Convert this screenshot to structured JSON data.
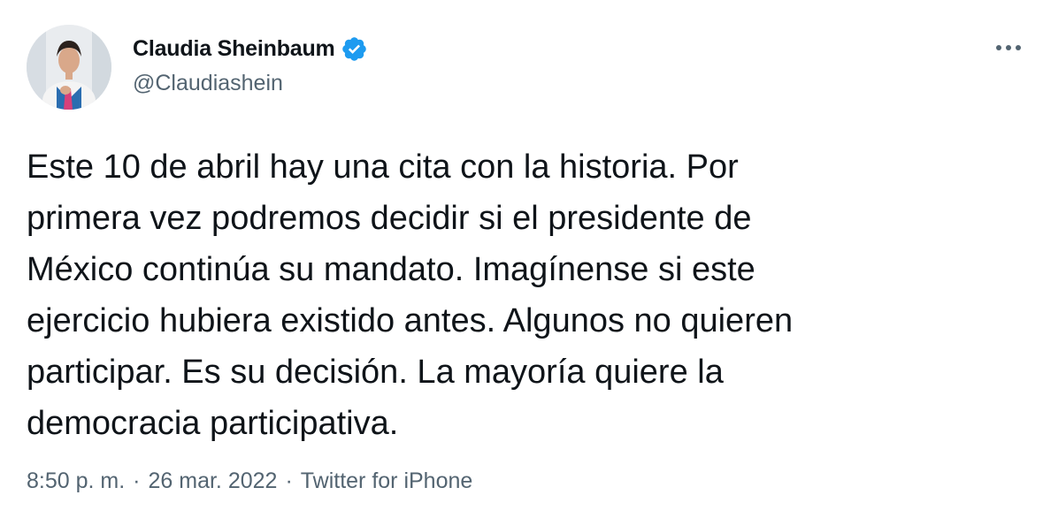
{
  "author": {
    "display_name": "Claudia Sheinbaum",
    "handle": "@Claudiashein",
    "verified": true
  },
  "tweet": {
    "text": "Este 10 de abril hay una cita con la historia. Por\nprimera vez podremos decidir si el presidente de\nMéxico continúa su mandato. Imagínense si este\nejercicio hubiera existido antes. Algunos no quieren\nparticipar. Es su decisión. La mayoría quiere la\ndemocracia participativa.",
    "time": "8:50 p. m.",
    "date": "26 mar. 2022",
    "source": "Twitter for iPhone",
    "separator": "·"
  },
  "colors": {
    "accent": "#1d9bf0",
    "text_primary": "#0f1419",
    "text_secondary": "#536471"
  },
  "icons": {
    "more": "more-horizontal-icon",
    "verified": "verified-badge-icon"
  }
}
